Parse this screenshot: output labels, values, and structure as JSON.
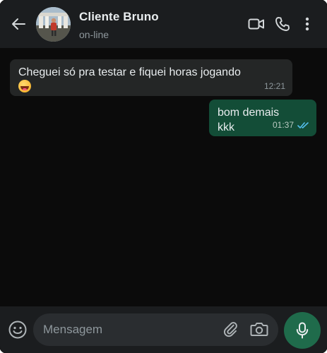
{
  "header": {
    "contact_name": "Cliente Bruno",
    "status": "on-line",
    "icons": [
      "back-arrow-icon",
      "avatar",
      "video-call-icon",
      "phone-icon",
      "more-vert-icon"
    ]
  },
  "messages": [
    {
      "direction": "incoming",
      "text": "Cheguei só pra testar e fiquei horas jogando",
      "emoji": "laughing-face-emoji",
      "time": "12:21"
    },
    {
      "direction": "outgoing",
      "text": "bom demais kkk",
      "time": "01:37",
      "status": "read"
    }
  ],
  "composer": {
    "placeholder": "Mensagem",
    "icons": [
      "emoji-icon",
      "attach-icon",
      "camera-icon",
      "mic-icon"
    ]
  },
  "colors": {
    "background": "#0b0b0b",
    "header": "#1b1d1f",
    "incoming_bubble": "#242626",
    "outgoing_bubble": "#134d37",
    "read_ticks": "#53bdeb",
    "mic_button": "#1f6b4b"
  }
}
